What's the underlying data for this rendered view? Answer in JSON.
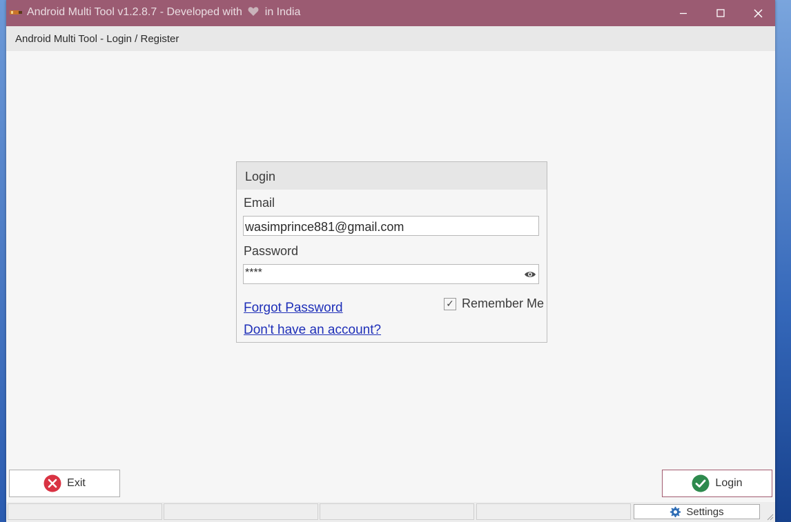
{
  "window": {
    "title_prefix": "Android Multi Tool v1.2.8.7 - Developed with",
    "title_suffix": "in India",
    "minimize_icon": "minimize-icon",
    "maximize_icon": "maximize-icon",
    "close_icon": "close-icon"
  },
  "subheader": {
    "title": "Android Multi Tool - Login / Register"
  },
  "login": {
    "heading": "Login",
    "email_label": "Email",
    "email_value": "wasimprince881@gmail.com",
    "password_label": "Password",
    "password_value": "****",
    "forgot_link": "Forgot Password",
    "register_link": "Don't have an account?",
    "remember_label": "Remember Me",
    "remember_checked": true
  },
  "buttons": {
    "exit_label": "Exit",
    "login_label": "Login"
  },
  "statusbar": {
    "settings_label": "Settings"
  },
  "colors": {
    "titlebar": "#9b5b72",
    "exit_icon": "#d93343",
    "login_icon": "#2e8a4e",
    "link": "#1e2fb8",
    "settings_icon": "#2e6db5"
  }
}
